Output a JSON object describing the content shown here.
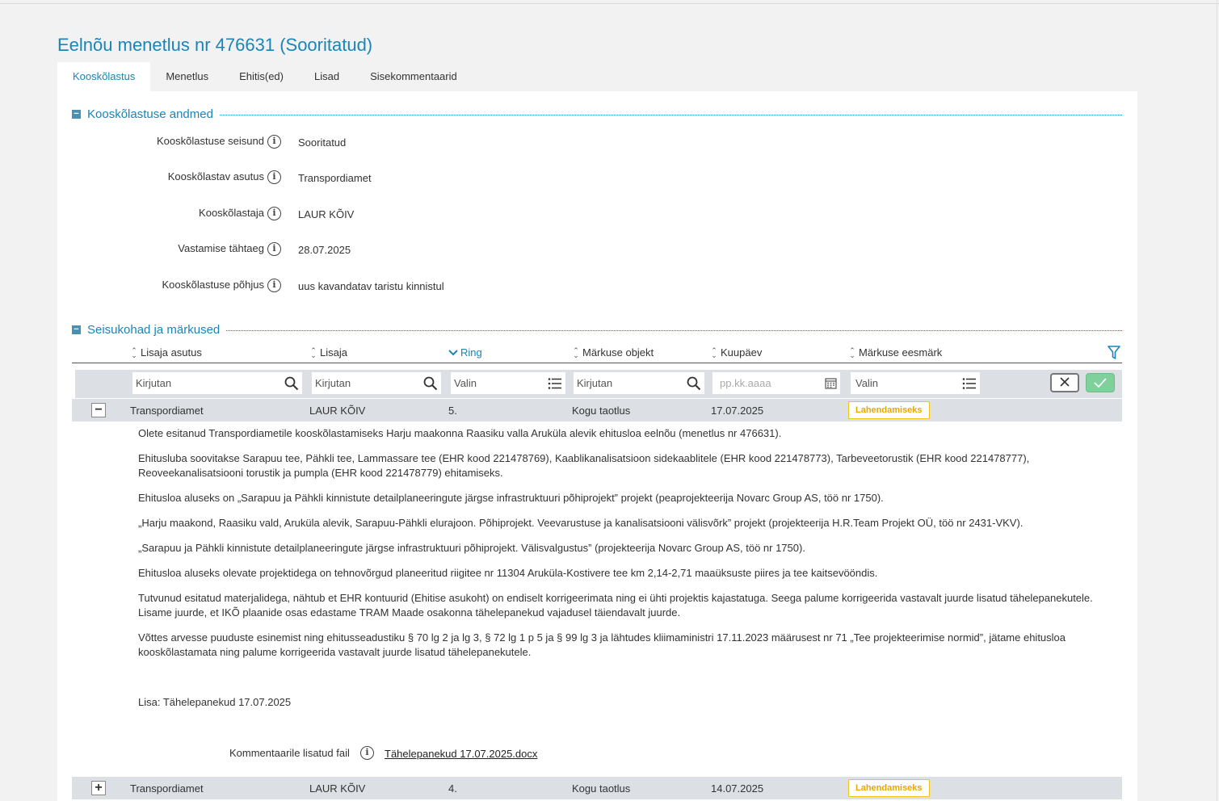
{
  "page_title": "Eelnõu menetlus nr 476631 (Sooritatud)",
  "tabs": [
    {
      "label": "Kooskõlastus",
      "active": true
    },
    {
      "label": "Menetlus"
    },
    {
      "label": "Ehitis(ed)"
    },
    {
      "label": "Lisad"
    },
    {
      "label": "Sisekommentaarid"
    }
  ],
  "section1": {
    "title": "Kooskõlastuse andmed",
    "fields": [
      {
        "label": "Kooskõlastuse seisund",
        "value": "Sooritatud"
      },
      {
        "label": "Kooskõlastav asutus",
        "value": "Transpordiamet"
      },
      {
        "label": "Kooskõlastaja",
        "value": "LAUR KÕIV"
      },
      {
        "label": "Vastamise tähtaeg",
        "value": "28.07.2025"
      },
      {
        "label": "Kooskõlastuse põhjus",
        "value": "uus kavandatav taristu kinnistul"
      }
    ]
  },
  "section2": {
    "title": "Seisukohad ja märkused",
    "columns": [
      "Lisaja asutus",
      "Lisaja",
      "Ring",
      "Märkuse objekt",
      "Kuupäev",
      "Märkuse eesmärk"
    ],
    "filters": {
      "f1": "Kirjutan",
      "f2": "Kirjutan",
      "f3": "Valin",
      "f4": "Kirjutan",
      "f5": "pp.kk.aaaa",
      "f6": "Valin"
    },
    "rows": [
      {
        "expanded": true,
        "toggle": "−",
        "asutus": "Transpordiamet",
        "lisaja": "LAUR KÕIV",
        "ring": "5.",
        "objekt": "Kogu taotlus",
        "kuupaev": "17.07.2025",
        "eesmark": "Lahendamiseks"
      },
      {
        "expanded": false,
        "toggle": "+",
        "asutus": "Transpordiamet",
        "lisaja": "LAUR KÕIV",
        "ring": "4.",
        "objekt": "Kogu taotlus",
        "kuupaev": "14.07.2025",
        "eesmark": "Lahendamiseks"
      }
    ],
    "comment": {
      "p1": "Olete esitanud Transpordiametile kooskõlastamiseks Harju maakonna Raasiku valla Aruküla alevik ehitusloa eelnõu (menetlus nr 476631).",
      "p2": "Ehitusluba soovitakse Sarapuu tee, Pähkli tee, Lammassare tee (EHR kood 221478769), Kaablikanalisatsioon sidekaablitele (EHR kood 221478773), Tarbeveetorustik (EHR kood 221478777), Reoveekanalisatsiooni torustik ja pumpla (EHR kood 221478779) ehitamiseks.",
      "p3": "Ehitusloa aluseks on „Sarapuu ja Pähkli kinnistute detailplaneeringute järgse infrastruktuuri põhiprojekt” projekt (peaprojekteerija Novarc Group AS, töö nr 1750).",
      "p4": "„Harju maakond, Raasiku vald, Aruküla alevik, Sarapuu-Pähkli elurajoon. Põhiprojekt. Veevarustuse ja kanalisatsiooni välisvõrk” projekt (projekteerija H.R.Team Projekt OÜ, töö nr 2431-VKV).",
      "p5": "„Sarapuu ja Pähkli kinnistute detailplaneeringute järgse infrastruktuuri põhiprojekt. Välisvalgustus” (projekteerija Novarc Group AS, töö nr 1750).",
      "p6": "Ehitusloa aluseks olevate projektidega on tehnovõrgud planeeritud riigitee nr 11304 Aruküla-Kostivere tee km 2,14-2,71 maaüksuste piires ja tee kaitsevööndis.",
      "p7": "Tutvunud esitatud materjalidega, nähtub et EHR kontuurid (Ehitise asukoht) on endiselt korrigeerimata ning ei ühti projektis kajastatuga. Seega palume korrigeerida vastavalt juurde lisatud tähelepanekutele. Lisame juurde, et IKÕ plaanide osas edastame TRAM Maade osakonna tähelepanekud vajadusel täiendavalt juurde.",
      "p8": "Võttes arvesse puuduste esinemist ning ehitusseadustiku § 70 lg 2 ja lg 3, § 72 lg 1 p 5 ja § 99 lg 3 ja lähtudes kliimaministri 17.11.2023 määrusest nr 71 „Tee projekteerimise normid”, jätame ehitusloa kooskõlastamata ning palume korrigeerida vastavalt juurde lisatud tähelepanekutele.",
      "p9": "Lisa: Tähelepanekud 17.07.2025"
    },
    "attachment": {
      "label": "Kommentaarile lisatud fail",
      "file": "Tähelepanekud 17.07.2025.docx"
    }
  }
}
